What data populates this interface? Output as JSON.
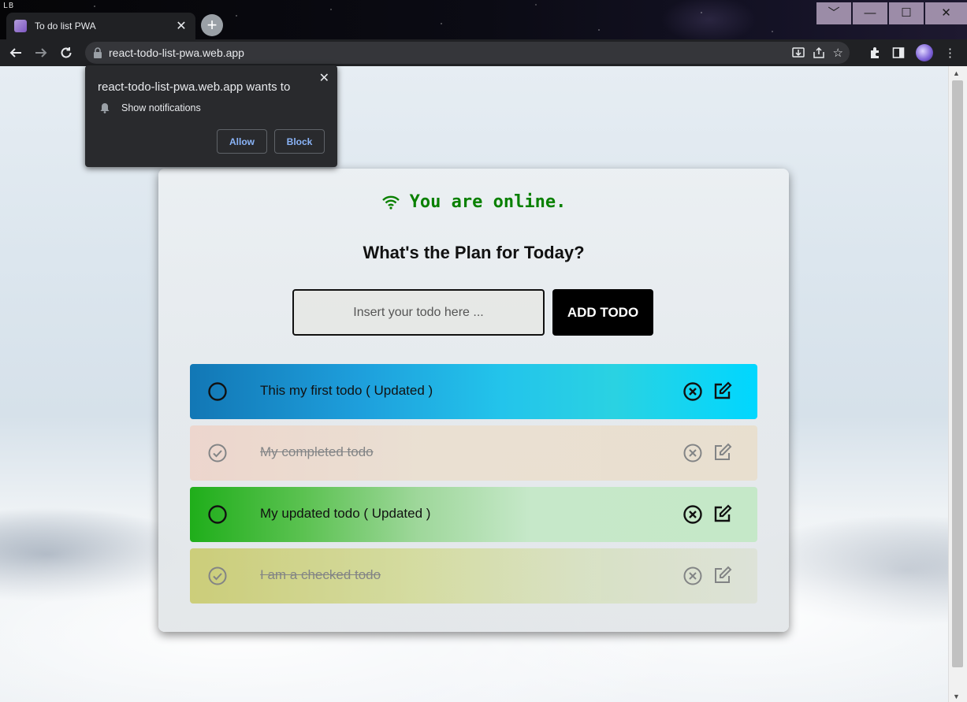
{
  "browser": {
    "os_logo": "LB",
    "tab_title": "To do list PWA",
    "new_tab_label": "+",
    "url": "react-todo-list-pwa.web.app",
    "window_buttons": [
      "﹀",
      "—",
      "☐",
      "✕"
    ]
  },
  "permission_popup": {
    "title": "react-todo-list-pwa.web.app wants to",
    "item": "Show notifications",
    "allow_label": "Allow",
    "block_label": "Block"
  },
  "app": {
    "status": "You are online.",
    "heading": "What's the Plan for Today?",
    "input_placeholder": "Insert your todo here ...",
    "add_button": "ADD TODO",
    "todos": [
      {
        "text": "This my first todo ( Updated )",
        "completed": false
      },
      {
        "text": "My completed todo",
        "completed": true
      },
      {
        "text": "My updated todo ( Updated )",
        "completed": false
      },
      {
        "text": "I am a checked todo",
        "completed": true
      }
    ]
  },
  "colors": {
    "status_green": "#098000",
    "link_blue": "#8ab4f8",
    "chrome_dark": "#202124"
  }
}
